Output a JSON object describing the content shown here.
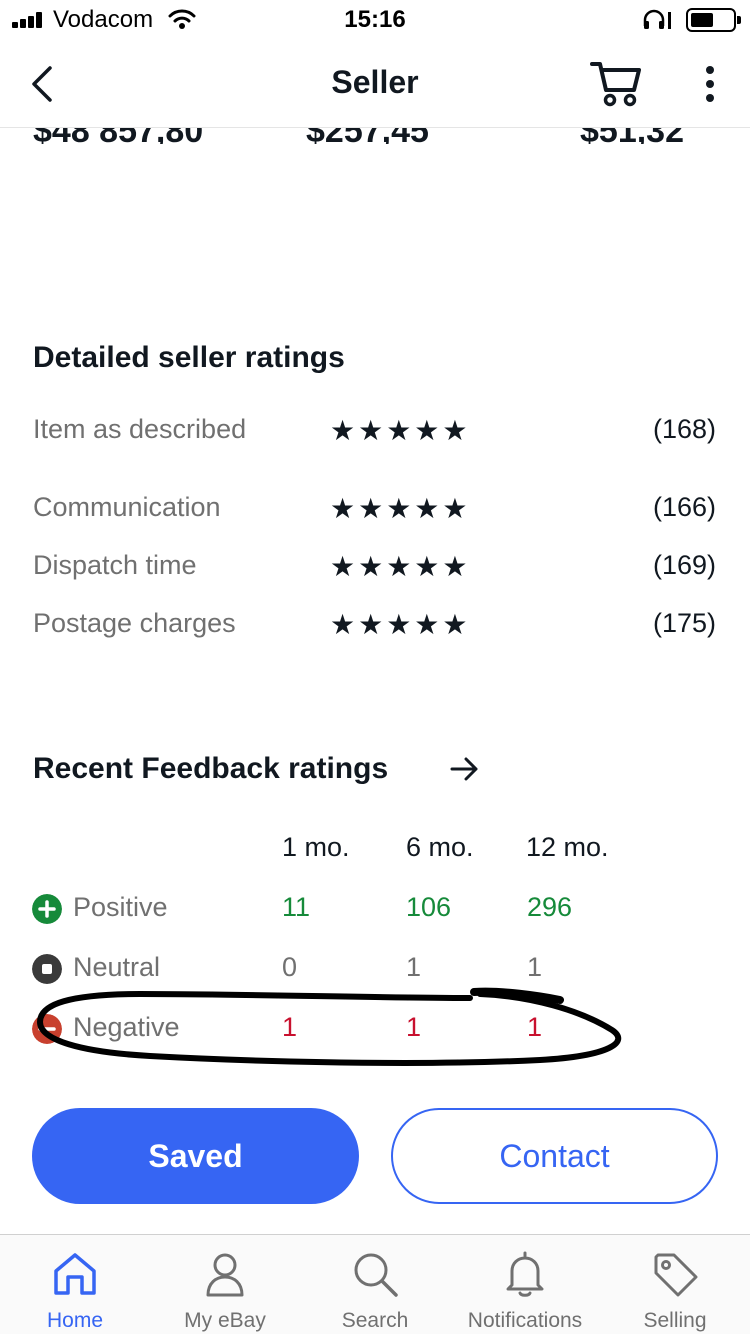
{
  "status_bar": {
    "carrier": "Vodacom",
    "time": "15:16"
  },
  "nav": {
    "title": "Seller",
    "icons": [
      "back-arrow",
      "cart",
      "more-vertical"
    ]
  },
  "amounts": {
    "values": [
      "$48 857,80",
      "$257,45",
      "$51,32"
    ]
  },
  "dsr": {
    "title": "Detailed seller ratings",
    "rows": [
      {
        "label": "Item as described",
        "stars": "★★★★★",
        "count": "(168)"
      },
      {
        "label": "Communication",
        "stars": "★★★★★",
        "count": "(166)"
      },
      {
        "label": "Dispatch time",
        "stars": "★★★★★",
        "count": "(169)"
      },
      {
        "label": "Postage charges",
        "stars": "★★★★★",
        "count": "(175)"
      }
    ]
  },
  "feedback": {
    "title": "Recent Feedback ratings",
    "columns": [
      "1 mo.",
      "6 mo.",
      "12 mo."
    ],
    "rows": [
      {
        "label": "Positive",
        "values": [
          "11",
          "106",
          "296"
        ],
        "color": "#168a3a",
        "icon": "plus-circle"
      },
      {
        "label": "Neutral",
        "values": [
          "0",
          "1",
          "1"
        ],
        "color": "#707070",
        "icon": "square-circle"
      },
      {
        "label": "Negative",
        "values": [
          "1",
          "1",
          "1"
        ],
        "color": "#c8102e",
        "icon": "minus-circle"
      }
    ]
  },
  "actions": {
    "saved": "Saved",
    "contact": "Contact"
  },
  "tabs": [
    {
      "label": "Home",
      "icon": "home",
      "active": true
    },
    {
      "label": "My eBay",
      "icon": "person"
    },
    {
      "label": "Search",
      "icon": "search"
    },
    {
      "label": "Notifications",
      "icon": "bell"
    },
    {
      "label": "Selling",
      "icon": "tag"
    }
  ],
  "colors": {
    "accent": "#3665f3",
    "positive": "#168a3a",
    "negative": "#c8102e",
    "text": "#111820",
    "muted": "#707070"
  }
}
